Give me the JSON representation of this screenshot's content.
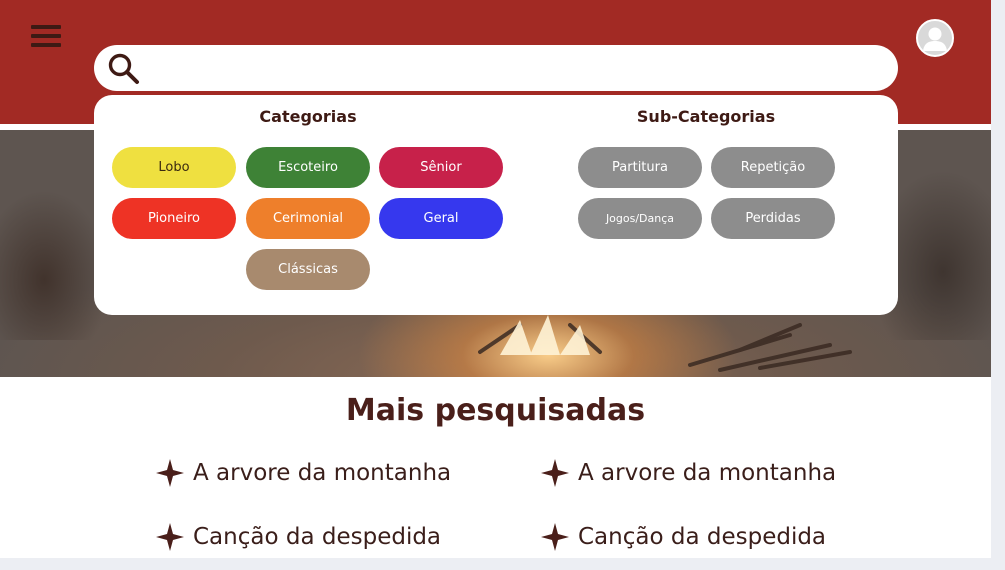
{
  "colors": {
    "header": "#a22a24",
    "text_dark": "#3e1a14",
    "sub_pill": "#8d8d8d"
  },
  "header": {
    "menu_icon": "hamburger-menu-icon",
    "avatar_icon": "user-avatar-icon"
  },
  "search": {
    "icon": "search-icon",
    "value": "",
    "placeholder": ""
  },
  "dropdown": {
    "categories_title": "Categorias",
    "subcategories_title": "Sub-Categorias",
    "categories": [
      {
        "label": "Lobo",
        "color": "#efe040"
      },
      {
        "label": "Escoteiro",
        "color": "#3e8236"
      },
      {
        "label": "Sênior",
        "color": "#c7214a"
      },
      {
        "label": "Pioneiro",
        "color": "#ee3325"
      },
      {
        "label": "Cerimonial",
        "color": "#ee7f2b"
      },
      {
        "label": "Geral",
        "color": "#3638ee"
      },
      {
        "label": "Clássicas",
        "color": "#a88a6e"
      }
    ],
    "subcategories": [
      {
        "label": "Partitura"
      },
      {
        "label": "Repetição"
      },
      {
        "label": "Jogos/Dança"
      },
      {
        "label": "Perdidas"
      }
    ]
  },
  "popular": {
    "title": "Mais pesquisadas",
    "icon": "four-point-star-icon",
    "items": [
      {
        "label": "A arvore da montanha"
      },
      {
        "label": "A arvore da montanha"
      },
      {
        "label": "Canção da despedida"
      },
      {
        "label": "Canção da despedida"
      }
    ]
  }
}
